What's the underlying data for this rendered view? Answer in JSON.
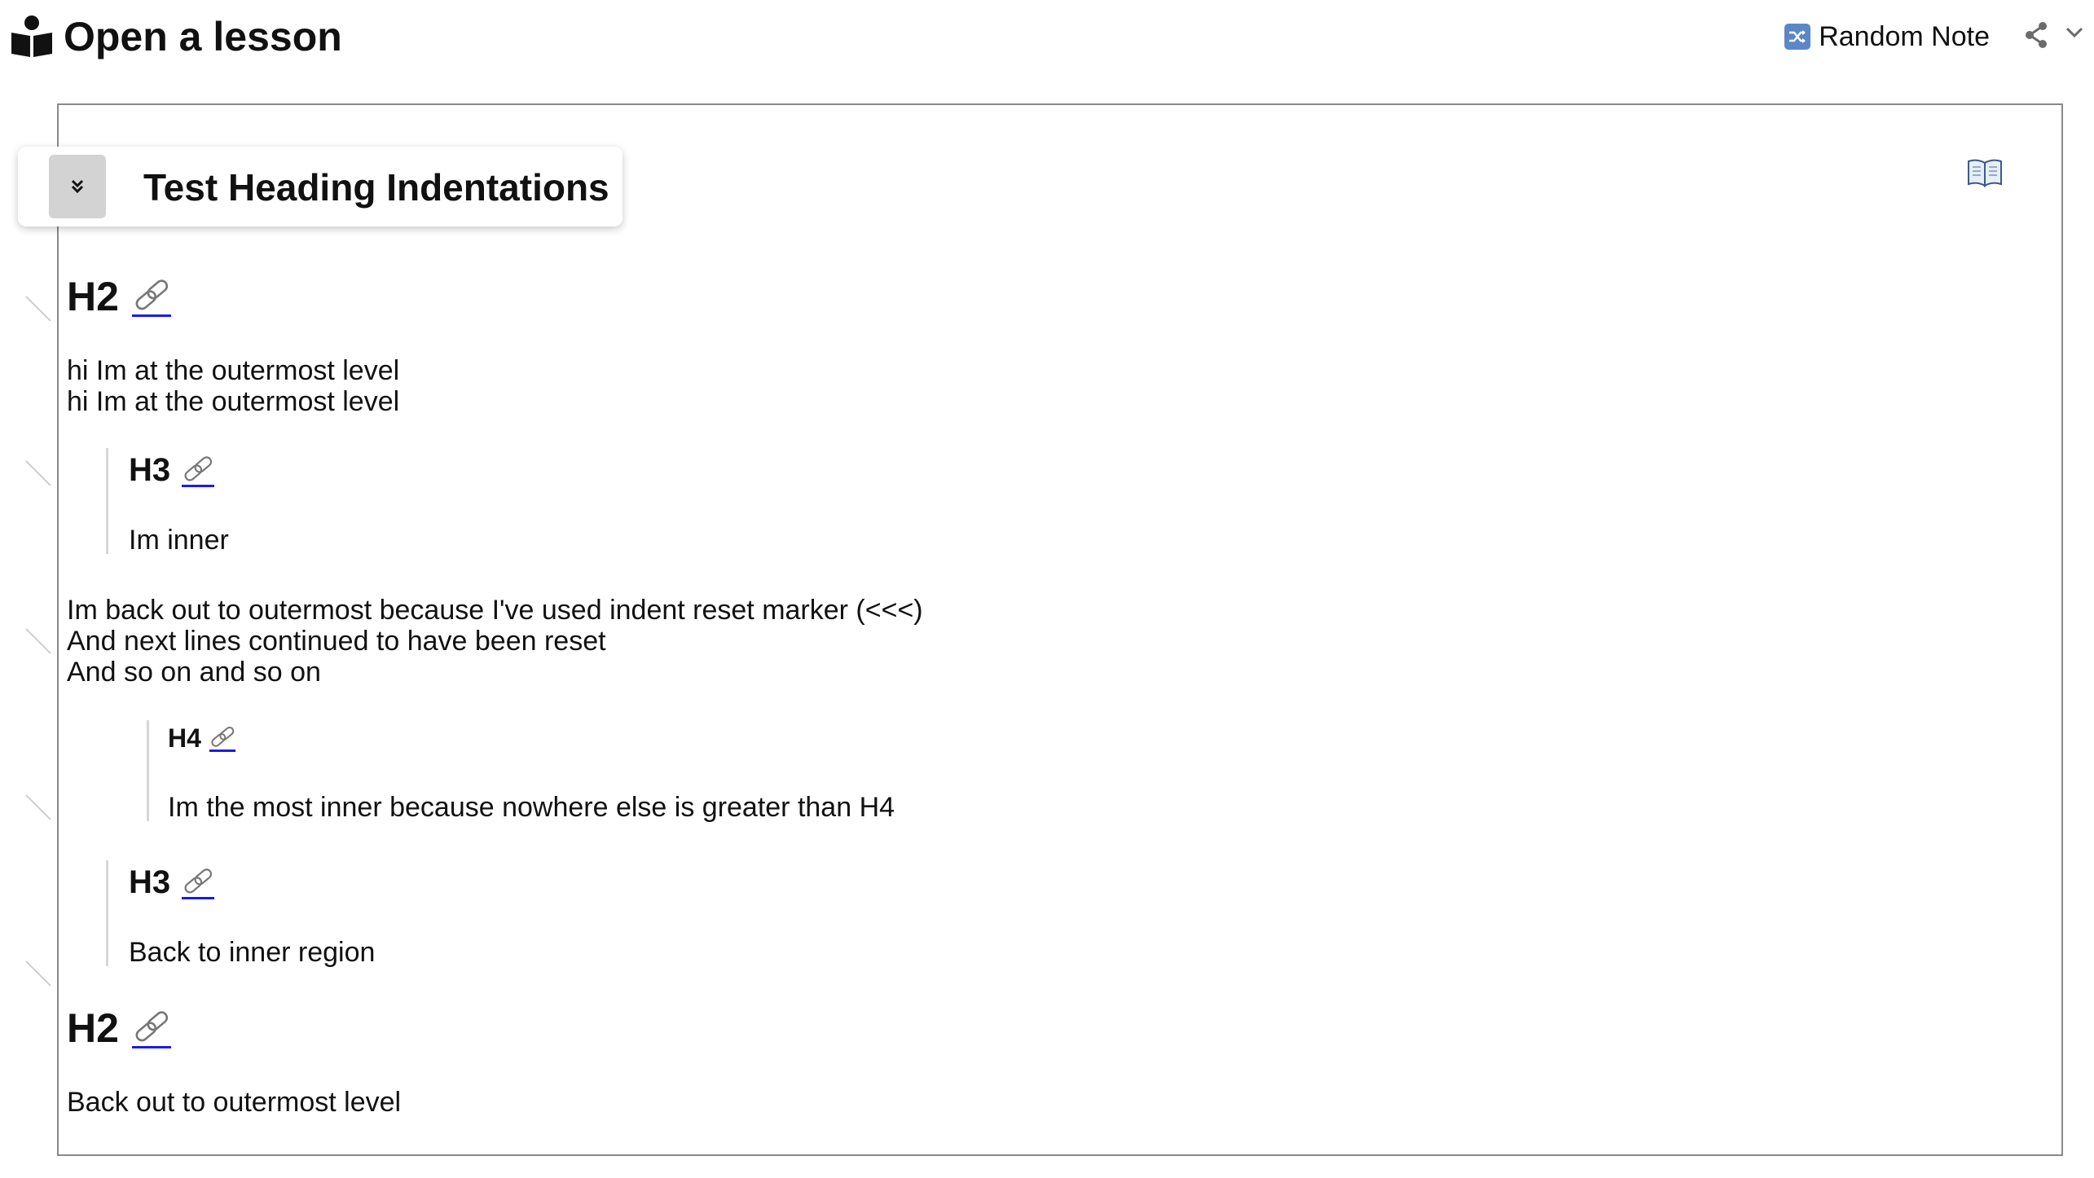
{
  "header": {
    "title": "Open a lesson",
    "random_note_label": "Random Note"
  },
  "lesson": {
    "title": "Test Heading Indentations"
  },
  "content": {
    "h2_first": "H2",
    "para1_line1": "hi Im at the outermost level",
    "para1_line2": "hi Im at the outermost level",
    "h3_first": "H3",
    "para_inner": "Im inner",
    "para_reset_line1": "Im back out to outermost because I've used indent reset marker (<<<)",
    "para_reset_line2": "And next lines continued to have been reset",
    "para_reset_line3": "And so on and so on",
    "h4": "H4",
    "para_most_inner": "Im the most inner because nowhere else is greater than H4",
    "h3_second": "H3",
    "para_back_inner": "Back to inner region",
    "h2_second": "H2",
    "para_back_outer": "Back out to outermost level"
  },
  "colors": {
    "link": "#1a1aee",
    "frame_border": "#8a8a8a",
    "collapse_button_bg": "#d3d3d3"
  },
  "icons": [
    "book-reader-icon",
    "shuffle-icon",
    "share-icon",
    "chevron-down-icon",
    "double-chevron-down-icon",
    "open-book-icon",
    "link-icon",
    "fold-marker-icon"
  ]
}
